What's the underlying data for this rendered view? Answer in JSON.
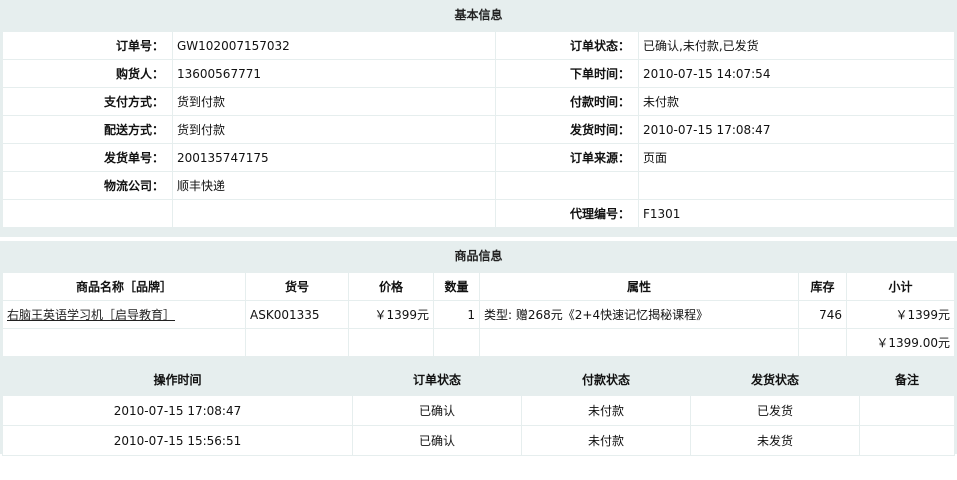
{
  "basic": {
    "title": "基本信息",
    "order_no_label": "订单号：",
    "order_no": "GW102007157032",
    "order_status_label": "订单状态：",
    "order_status": "已确认,未付款,已发货",
    "buyer_label": "购货人：",
    "buyer": "13600567771",
    "order_time_label": "下单时间：",
    "order_time": "2010-07-15 14:07:54",
    "pay_method_label": "支付方式：",
    "pay_method": "货到付款",
    "pay_time_label": "付款时间：",
    "pay_time": "未付款",
    "ship_method_label": "配送方式：",
    "ship_method": "货到付款",
    "ship_time_label": "发货时间：",
    "ship_time": "2010-07-15 17:08:47",
    "ship_no_label": "发货单号：",
    "ship_no": "200135747175",
    "order_source_label": "订单来源：",
    "order_source": "页面",
    "logistics_label": "物流公司：",
    "logistics": "顺丰快递",
    "agent_label": "代理编号：",
    "agent": "F1301"
  },
  "goods": {
    "title": "商品信息",
    "headers": [
      "商品名称［品牌］",
      "货号",
      "价格",
      "数量",
      "属性",
      "库存",
      "小计"
    ],
    "rows": [
      {
        "name": "右脑王英语学习机［启导教育］",
        "sku": "ASK001335",
        "price": "￥1399元",
        "qty": "1",
        "attr": "类型: 赠268元《2+4快速记忆揭秘课程》",
        "stock": "746",
        "subtotal": "￥1399元"
      }
    ],
    "total": "￥1399.00元"
  },
  "log": {
    "headers": [
      "操作时间",
      "订单状态",
      "付款状态",
      "发货状态",
      "备注"
    ],
    "rows": [
      {
        "time": "2010-07-15 17:08:47",
        "order": "已确认",
        "pay": "未付款",
        "ship": "已发货",
        "note": ""
      },
      {
        "time": "2010-07-15 15:56:51",
        "order": "已确认",
        "pay": "未付款",
        "ship": "未发货",
        "note": ""
      }
    ]
  }
}
